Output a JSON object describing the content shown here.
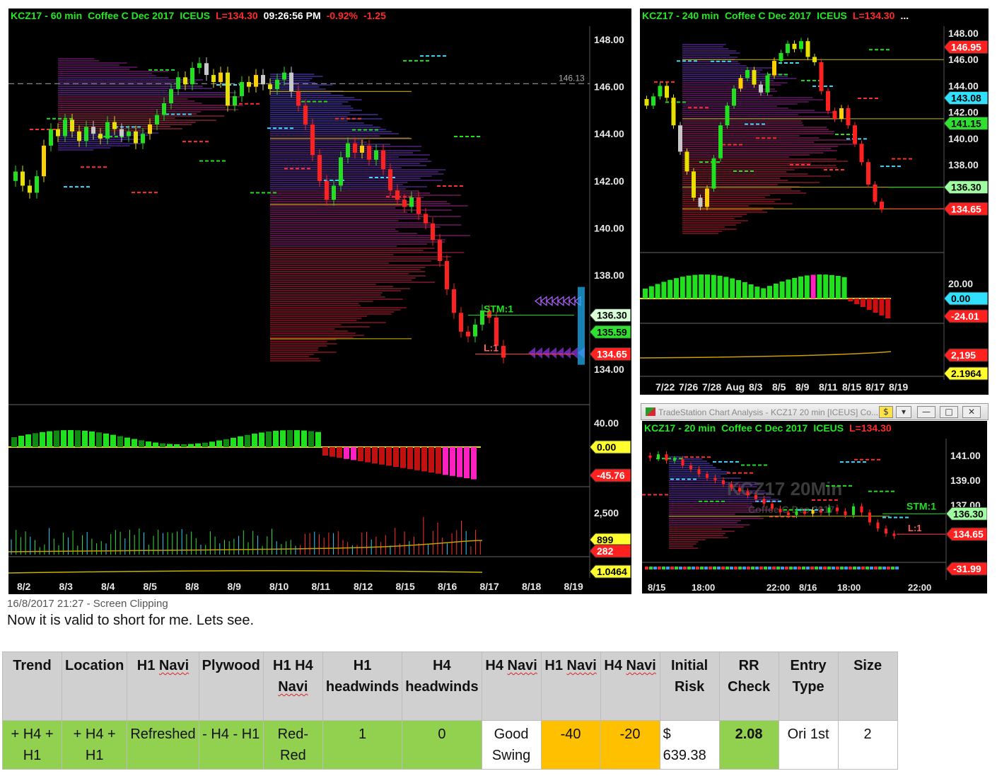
{
  "chart60": {
    "title": [
      "KCZ17 - 60 min",
      "Coffee C Dec 2017",
      "ICEUS",
      "L=134.30",
      "09:26:56 PM",
      "-0.92%",
      "-1.25"
    ],
    "ref_line_label": "146.13",
    "y_ticks": [
      "148.00",
      "146.00",
      "144.00",
      "142.00",
      "140.00",
      "138.00",
      "134.00"
    ],
    "price_tags": [
      "136.30",
      "135.59",
      "134.65"
    ],
    "annotations": [
      "STM:1",
      "L:1"
    ],
    "osc_ticks": [
      "40.00"
    ],
    "osc_tags": [
      "0.00",
      "-45.76"
    ],
    "vol_ticks": [
      "2,500"
    ],
    "vol_tags": [
      "899",
      "282"
    ],
    "bottom_tag": "1.0464",
    "x_labels": [
      "8/2",
      "8/3",
      "8/4",
      "8/5",
      "8/8",
      "8/9",
      "8/10",
      "8/11",
      "8/12",
      "8/15",
      "8/16",
      "8/17",
      "8/18",
      "8/19"
    ]
  },
  "chart240": {
    "title": [
      "KCZ17 - 240 min",
      "Coffee C Dec 2017",
      "ICEUS",
      "L=134.30",
      "..."
    ],
    "y_ticks": [
      "148.00",
      "146.00",
      "144.00",
      "142.00",
      "140.00",
      "138.00"
    ],
    "price_tags": [
      "146.95",
      "143.08",
      "141.15",
      "136.30",
      "134.65"
    ],
    "osc_ticks": [
      "20.00"
    ],
    "osc_tags": [
      "0.00",
      "-24.01"
    ],
    "vol_tags": [
      "2,195",
      "2.1964"
    ],
    "x_labels": [
      "7/22",
      "7/26",
      "7/28",
      "Aug",
      "8/3",
      "8/5",
      "8/9",
      "8/11",
      "8/15",
      "8/17",
      "8/19"
    ]
  },
  "chart20": {
    "window_title": "TradeStation Chart Analysis - KCZ17 20 min [ICEUS] Co...",
    "title": [
      "KCZ17 - 20 min",
      "Coffee C Dec 2017",
      "ICEUS",
      "L=134.30"
    ],
    "watermark": "KCZ17 20Min",
    "watermark_sub": "Coffee C Dec 2017",
    "y_ticks": [
      "141.00",
      "139.00",
      "137.00"
    ],
    "price_tags": [
      "136.30",
      "134.65"
    ],
    "annotations": [
      "STM:1",
      "L:1"
    ],
    "osc_tags": [
      "-31.99"
    ],
    "x_labels": [
      "8/15",
      "18:00",
      "22:00",
      "8/16",
      "18:00",
      "22:00"
    ]
  },
  "caption": {
    "meta": "16/8/2017 21:27 - Screen Clipping",
    "note": "Now it is valid to short for me. Lets see."
  },
  "table": {
    "headers": [
      "Trend",
      "Location",
      "H1 Navi",
      "Plywood",
      "H1 H4 Navi",
      "H1 headwinds",
      "H4 headwinds",
      "H4 Navi",
      "H1 Navi",
      "H4 Navi",
      "Initial Risk",
      "RR Check",
      "Entry Type",
      "Size"
    ],
    "values": [
      "+ H4 + H1",
      "+ H4 + H1",
      "Refreshed",
      "- H4 - H1",
      "Red-Red",
      "1",
      "0",
      "Good Swing",
      "-40",
      "-20",
      "$ 639.38",
      "2.08",
      "Ori 1st",
      "2"
    ],
    "colors": {
      "green": "#92d050",
      "orange": "#ffc000",
      "header": "#d0d0d0"
    }
  }
}
